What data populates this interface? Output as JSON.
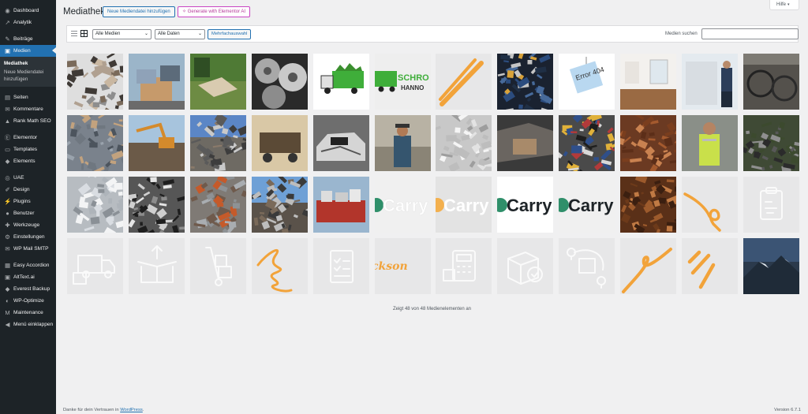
{
  "sidebar": {
    "items": [
      {
        "label": "Dashboard",
        "icon": "dashboard-icon",
        "glyph": "◉"
      },
      {
        "label": "Analytik",
        "icon": "analytics-icon",
        "glyph": "↗"
      },
      {
        "label": "Beiträge",
        "icon": "pin-icon",
        "glyph": "✎"
      },
      {
        "label": "Medien",
        "icon": "media-icon",
        "glyph": "▣",
        "active": true
      },
      {
        "label": "Seiten",
        "icon": "page-icon",
        "glyph": "▤"
      },
      {
        "label": "Kommentare",
        "icon": "comment-icon",
        "glyph": "✉"
      },
      {
        "label": "Rank Math SEO",
        "icon": "rankmath-icon",
        "glyph": "▲"
      },
      {
        "label": "Elementor",
        "icon": "elementor-icon",
        "glyph": "Ⓔ"
      },
      {
        "label": "Templates",
        "icon": "templates-icon",
        "glyph": "▭"
      },
      {
        "label": "Elements",
        "icon": "elements-icon",
        "glyph": "◆"
      },
      {
        "label": "UAE",
        "icon": "uae-icon",
        "glyph": "◎"
      },
      {
        "label": "Design",
        "icon": "brush-icon",
        "glyph": "✐"
      },
      {
        "label": "Plugins",
        "icon": "plugin-icon",
        "glyph": "⚡"
      },
      {
        "label": "Benutzer",
        "icon": "user-icon",
        "glyph": "●"
      },
      {
        "label": "Werkzeuge",
        "icon": "wrench-icon",
        "glyph": "✚"
      },
      {
        "label": "Einstellungen",
        "icon": "settings-icon",
        "glyph": "⚙"
      },
      {
        "label": "WP Mail SMTP",
        "icon": "mail-icon",
        "glyph": "✉"
      },
      {
        "label": "Easy Accordion",
        "icon": "accordion-icon",
        "glyph": "▦"
      },
      {
        "label": "AltText.ai",
        "icon": "alttext-icon",
        "glyph": "▣"
      },
      {
        "label": "Everest Backup",
        "icon": "backup-icon",
        "glyph": "◆"
      },
      {
        "label": "WP-Optimize",
        "icon": "optimize-icon",
        "glyph": "◐"
      },
      {
        "label": "Maintenance",
        "icon": "maintenance-icon",
        "glyph": "M"
      },
      {
        "label": "Menü einklappen",
        "icon": "collapse-icon",
        "glyph": "◀"
      }
    ],
    "submenu": [
      "Mediathek",
      "Neue Mediendatei hinzufügen"
    ]
  },
  "header": {
    "title": "Mediathek",
    "add_button": "Neue Mediendatei hinzufügen",
    "ai_button": "Generate with Elementor AI",
    "help": "Hilfe"
  },
  "toolbar": {
    "filter_media": "Alle Medien",
    "filter_dates": "Alle Daten",
    "bulk_select": "Mehrfachauswahl",
    "search_label": "Medien suchen",
    "search_value": ""
  },
  "media_items": [
    "scrap-pile",
    "scrap-metal-boxes",
    "garden-debris",
    "hubcaps",
    "green-truck-logo",
    "green-truck-banner",
    "orange-double-stroke",
    "battery-pile",
    "error-404-note",
    "empty-room",
    "van-worker",
    "old-bicycles",
    "copper-cables",
    "excavator-scrap",
    "scrap-yard-sky",
    "scrap-cart",
    "car-wreck",
    "worker-hat",
    "crushed-cans",
    "broken-car",
    "car-pile",
    "rusty-pipes",
    "worker-vest",
    "cable-bundle",
    "aluminium-scrap",
    "metal-chips",
    "radiators",
    "scrap-yard-blue",
    "trailer-scrap",
    "carry-logo-1",
    "carry-logo-2",
    "carry-logo-3",
    "carry-logo-4",
    "rusty-bars",
    "orange-loop",
    "clipboard-icon-tile",
    "truck-box-icon",
    "open-box-icon",
    "hand-truck-icon",
    "orange-spiral",
    "checklist-icon",
    "jackson-signature",
    "calculator-icon",
    "box-check-icon",
    "route-box-icon",
    "orange-swirl",
    "orange-rays",
    "mountain-photo"
  ],
  "count_text": "Zeigt 48 von 48 Medienelementen an",
  "footer": {
    "prefix": "Danke für dein Vertrauen in ",
    "link": "WordPress",
    "suffix": ".",
    "version": "Version 6.7.1"
  },
  "tile_text": {
    "truck_word": "SCHRO",
    "truck_word2": "HANNO",
    "error_note": "Error 404",
    "carry": "Carry",
    "jackson": "ckson"
  }
}
